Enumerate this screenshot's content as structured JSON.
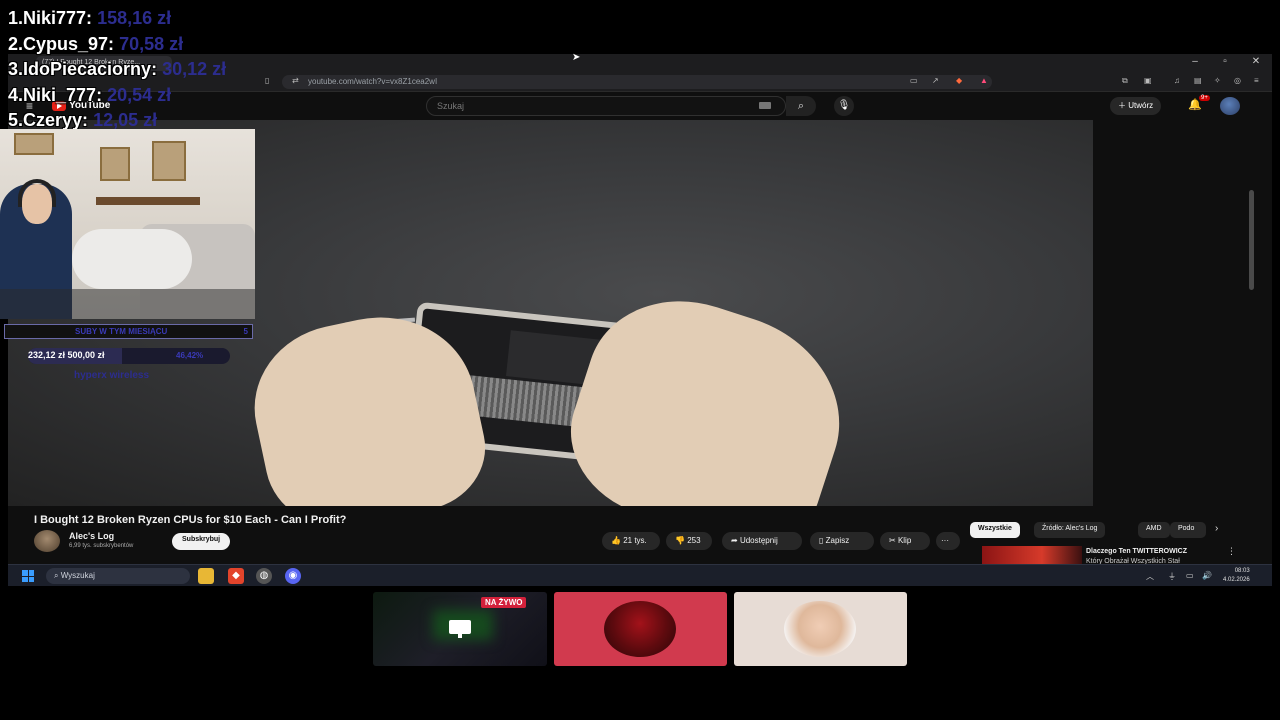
{
  "leaderboard": [
    {
      "rank": "1.",
      "name": "Niki777:",
      "amount": "158,16 zł"
    },
    {
      "rank": "2.",
      "name": "Cypus_97:",
      "amount": "70,58 zł"
    },
    {
      "rank": "3.",
      "name": "IdoPiecaciorny:",
      "amount": "30,12 zł"
    },
    {
      "rank": "4.",
      "name": "Niki_777:",
      "amount": "20,54 zł"
    },
    {
      "rank": "5.",
      "name": "Czeryy:",
      "amount": "12,05 zł"
    }
  ],
  "goals": {
    "bar_label": "SUBY W TYM MIESIĄCU",
    "bar_count": "5",
    "progress_text": "232,12 zł  500,00 zł",
    "progress_percent_text": "46,42%",
    "progress_fraction": 0.4642,
    "target_item": "hyperx wireless"
  },
  "browser": {
    "tab_title": "(77) I Bought 12 Broken Ryze...",
    "url": "youtube.com/watch?v=vx8Z1cea2wI"
  },
  "youtube": {
    "logo_text": "YouTube",
    "search_placeholder": "Szukaj",
    "create_label": "Utwórz",
    "notif_badge": "9+",
    "video_title": "I Bought 12 Broken Ryzen CPUs for $10 Each - Can I Profit?",
    "channel_name": "Alec's Log",
    "channel_subs": "6,99 tys. subskrybentów",
    "subscribe_label": "Subskrybuj",
    "likes": "21 tys.",
    "dislikes": "253",
    "share_label": "Udostępnij",
    "save_label": "Zapisz",
    "clip_label": "Klip",
    "more_label": "···",
    "chips": [
      "Wszystkie",
      "Źródło: Alec's Log",
      "AMD",
      "Podo"
    ],
    "rec_title": "Dlaczego Ten TWITTEROWICZ",
    "rec_title2": "Który Obrażał Wszystkich Stał"
  },
  "taskbar": {
    "search_placeholder": "Wyszukaj",
    "time": "08:03",
    "date": "4.02.2026"
  },
  "scenes": {
    "live_badge": "NA ŻYWO"
  },
  "colors": {
    "leaderboard_amount": "#2c2d8f",
    "live_red": "#d3213b",
    "youtube_red": "#e62117"
  }
}
